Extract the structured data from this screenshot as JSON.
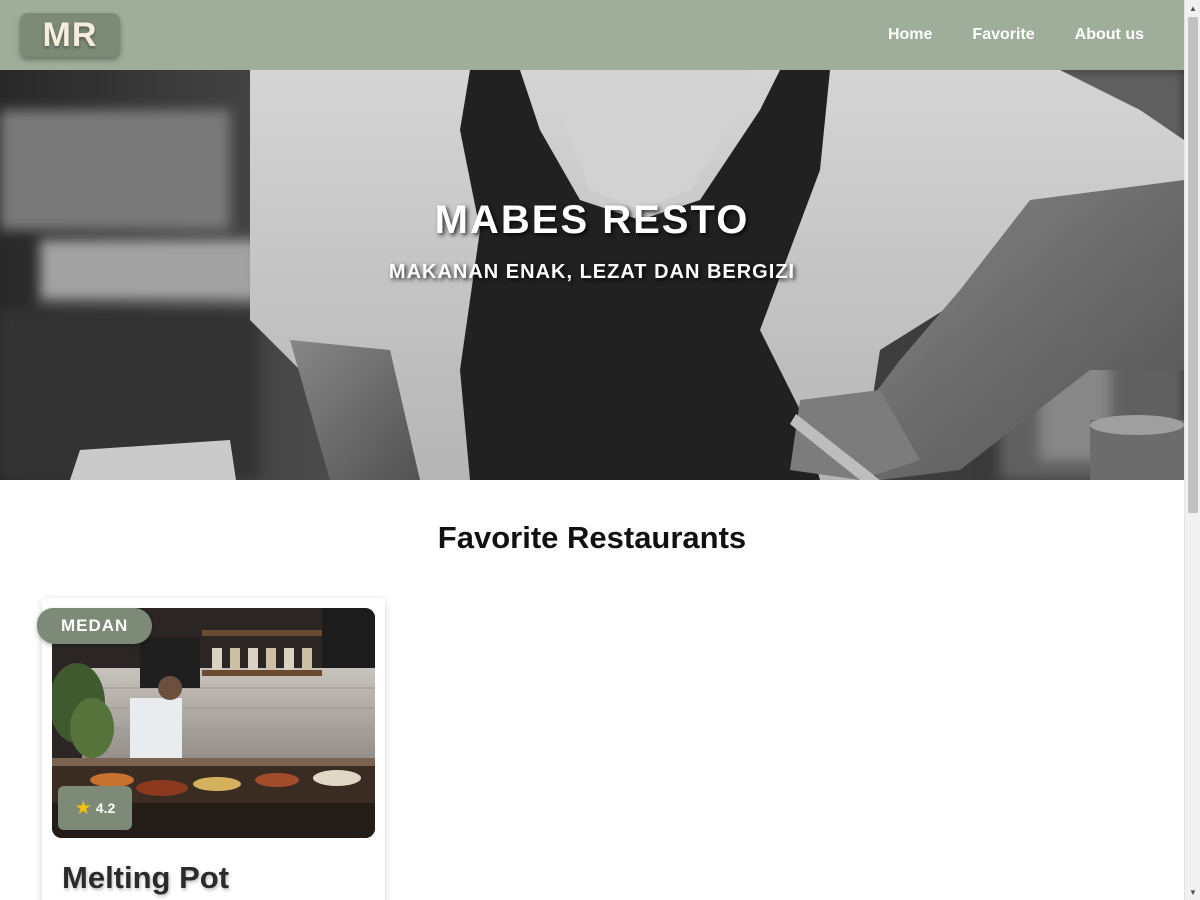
{
  "header": {
    "logo_text": "MR",
    "nav": [
      {
        "label": "Home"
      },
      {
        "label": "Favorite"
      },
      {
        "label": "About us"
      }
    ],
    "background_color": "#9fae9a"
  },
  "hero": {
    "title": "MABES RESTO",
    "subtitle": "MAKANAN ENAK, LEZAT DAN BERGIZI"
  },
  "main": {
    "section_title": "Favorite Restaurants",
    "restaurants": [
      {
        "city": "MEDAN",
        "rating": "4.2",
        "rating_icon": "star-icon",
        "name": "Melting Pot"
      }
    ]
  },
  "colors": {
    "accent": "#7d8a77",
    "star": "#f4c20d"
  }
}
